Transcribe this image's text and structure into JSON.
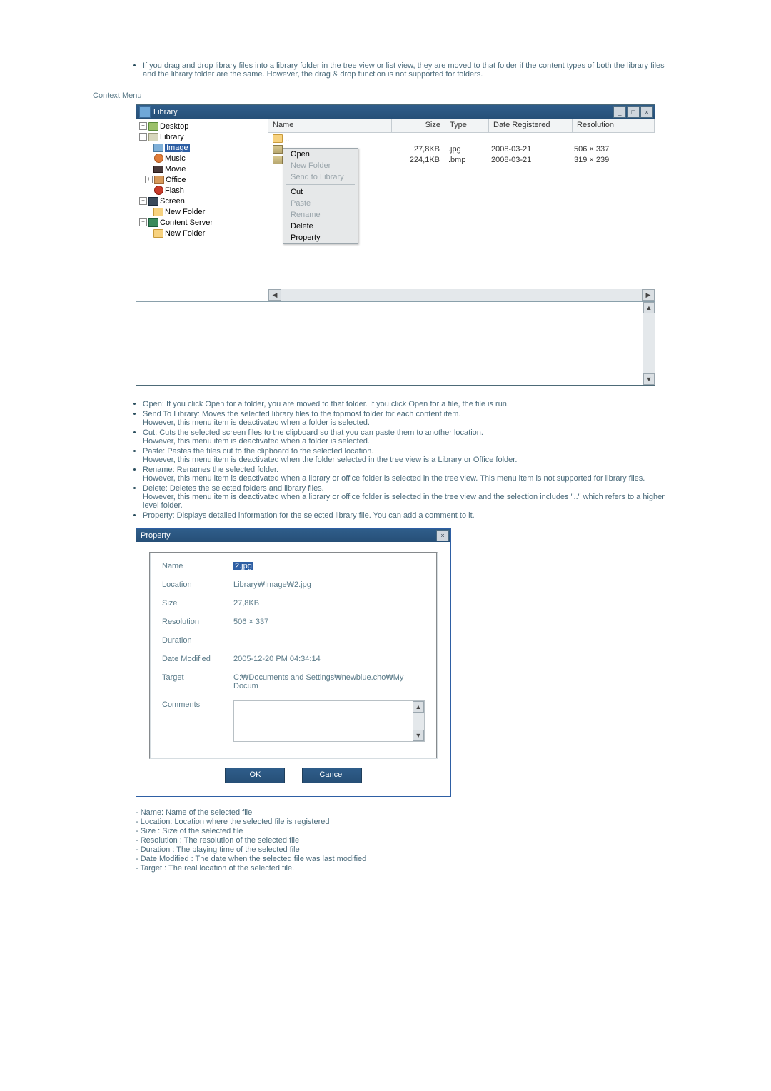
{
  "intro_bullet": "If you drag and drop library files into a library folder in the tree view or list view, they are moved to that folder if the content types of both the library files and the library folder are the same. However, the drag & drop function is not supported for folders.",
  "section_heading": "Context Menu",
  "library_window": {
    "title": "Library",
    "tree": {
      "desktop": "Desktop",
      "library": "Library",
      "image": "Image",
      "music": "Music",
      "movie": "Movie",
      "office": "Office",
      "flash": "Flash",
      "screen": "Screen",
      "new_folder_1": "New Folder",
      "content_server": "Content Server",
      "new_folder_2": "New Folder"
    },
    "columns": {
      "name": "Name",
      "size": "Size",
      "type": "Type",
      "date": "Date Registered",
      "res": "Resolution"
    },
    "up_row": "..",
    "rows": [
      {
        "size": "27,8KB",
        "type": ".jpg",
        "date": "2008-03-21",
        "res": "506 × 337"
      },
      {
        "size": "224,1KB",
        "type": ".bmp",
        "date": "2008-03-21",
        "res": "319 × 239"
      }
    ],
    "context_menu": {
      "open": "Open",
      "new_folder": "New Folder",
      "send_to_library": "Send to Library",
      "cut": "Cut",
      "paste": "Paste",
      "rename": "Rename",
      "delete": "Delete",
      "property": "Property"
    }
  },
  "bullets": [
    "Open: If you click Open for a folder, you are moved to that folder. If you click Open for a file, the file is run.",
    "Send To Library: Moves the selected library files to the topmost folder for each content item.\nHowever, this menu item is deactivated when a folder is selected.",
    "Cut: Cuts the selected screen files to the clipboard so that you can paste them to another location.\nHowever, this menu item is deactivated when a folder is selected.",
    "Paste: Pastes the files cut to the clipboard to the selected location.\nHowever, this menu item is deactivated when the folder selected in the tree view is a Library or Office folder.",
    "Rename: Renames the selected folder.\nHowever, this menu item is deactivated when a library or office folder is selected in the tree view. This menu item is not supported for library files.",
    "Delete: Deletes the selected folders and library files.\nHowever, this menu item is deactivated when a library or office folder is selected in the tree view and the selection includes \"..\" which refers to a higher level folder.",
    "Property: Displays detailed information for the selected library file. You can add a comment to it."
  ],
  "property_dialog": {
    "title": "Property",
    "labels": {
      "name": "Name",
      "location": "Location",
      "size": "Size",
      "resolution": "Resolution",
      "duration": "Duration",
      "date_modified": "Date Modified",
      "target": "Target",
      "comments": "Comments"
    },
    "values": {
      "name": "2.jpg",
      "location": "Library₩Image₩2.jpg",
      "size": "27,8KB",
      "resolution": "506 × 337",
      "duration": "",
      "date_modified": "2005-12-20 PM 04:34:14",
      "target": "C:₩Documents and Settings₩newblue.cho₩My Docum"
    },
    "buttons": {
      "ok": "OK",
      "cancel": "Cancel"
    }
  },
  "dash_list": [
    "- Name: Name of the selected file",
    "- Location: Location where the selected file is registered",
    "- Size : Size of the selected file",
    "- Resolution : The resolution of the selected file",
    "- Duration : The playing time of the selected file",
    "- Date Modified : The date when the selected file was last modified",
    "- Target : The real location of the selected file."
  ]
}
